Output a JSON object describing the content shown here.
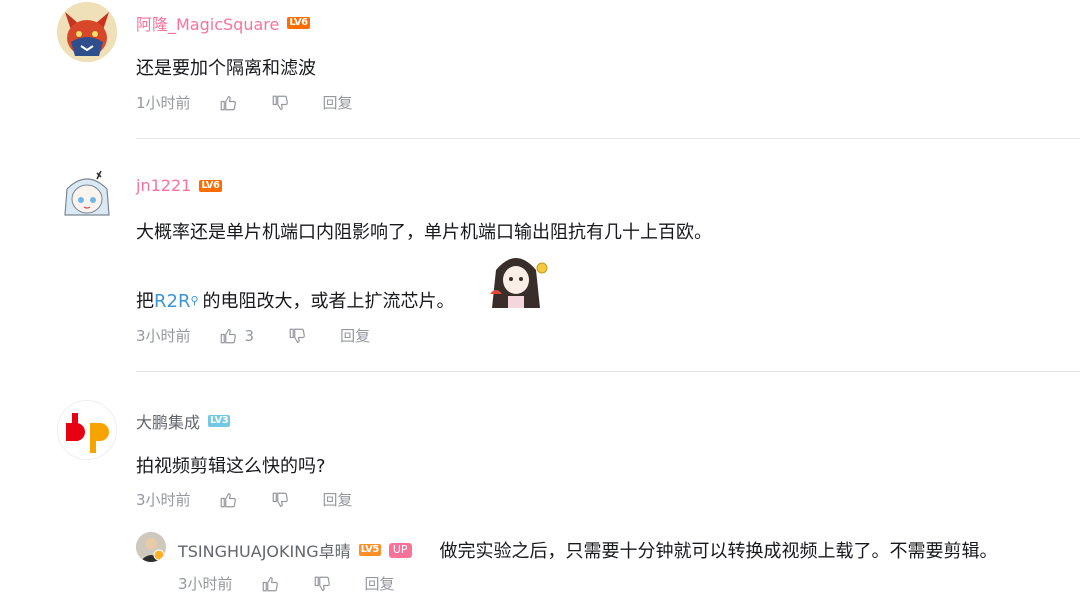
{
  "comments": [
    {
      "username": "阿隆_MagicSquare",
      "level": "LV6",
      "text": "还是要加个隔离和滤波",
      "time": "1小时前",
      "reply_label": "回复"
    },
    {
      "username": "jn1221",
      "level": "LV6",
      "text_line1": "大概率还是单片机端口内阻影响了，单片机端口输出阻抗有几十上百欧。",
      "text_line2_prefix": "把",
      "text_line2_link": "R2R",
      "text_line2_suffix": "的电阻改大，或者上扩流芯片。",
      "time": "3小时前",
      "like_count": "3",
      "reply_label": "回复"
    },
    {
      "username": "大鹏集成",
      "level": "LV3",
      "text": "拍视频剪辑这么快的吗?",
      "time": "3小时前",
      "reply_label": "回复",
      "avatar_text": "dp",
      "sub_reply": {
        "username": "TSINGHUAJOKING卓晴",
        "level": "LV5",
        "up_badge": "UP",
        "text": "做完实验之后，只需要十分钟就可以转换成视频上载了。不需要剪辑。",
        "time": "3小时前",
        "reply_label": "回复"
      }
    }
  ],
  "colors": {
    "link": "#3d94d6",
    "pink_name": "#fb7299",
    "meta": "#9499a0",
    "lv6": "#ff6c00",
    "lv3": "#73c9e5"
  }
}
